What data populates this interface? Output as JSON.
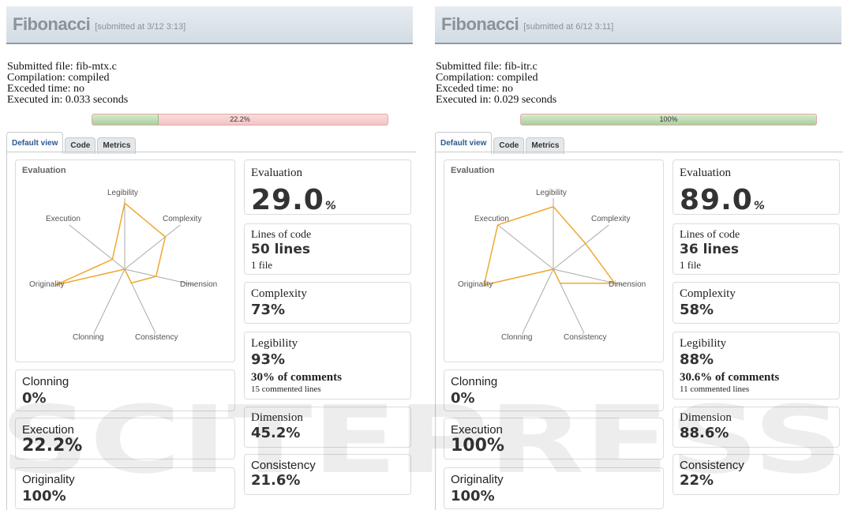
{
  "colors": {
    "orange": "#f0a830",
    "axis": "#aaaaaa",
    "header_text": "#8a929a",
    "tab_active": "#2b5893",
    "progress_red": "#f4c4c4",
    "progress_green": "#a9cf9c"
  },
  "panels": [
    {
      "header": {
        "title": "Fibonacci",
        "subtitle": "[submitted at 3/12 3:13]"
      },
      "info": {
        "submitted_file": "Submitted file: fib-mtx.c",
        "compilation": "Compilation: compiled",
        "exceeded_time": "Exceded time: no",
        "executed_in": "Executed in: 0.033 seconds"
      },
      "progress": {
        "label": "22.2%",
        "fraction": 0.222
      },
      "tabs": {
        "default_view": "Default view",
        "code": "Code",
        "metrics": "Metrics"
      },
      "radar": {
        "title": "Evaluation",
        "axes": [
          "Legibility",
          "Complexity",
          "Dimension",
          "Consistency",
          "Clonning",
          "Originality",
          "Execution"
        ],
        "values": [
          0.93,
          0.73,
          0.452,
          0.216,
          0.0,
          1.0,
          0.222
        ]
      },
      "evaluation": {
        "title": "Evaluation",
        "value": "29.0",
        "unit": "%"
      },
      "lines_of_code": {
        "title": "Lines of code",
        "value": "50 lines",
        "files": "1 file"
      },
      "complexity": {
        "title": "Complexity",
        "value": "73%"
      },
      "legibility": {
        "title": "Legibility",
        "value": "93%",
        "comments": "30% of comments",
        "commented_lines": "15 commented lines"
      },
      "dimension": {
        "title": "Dimension",
        "value": "45.2%"
      },
      "consistency": {
        "title": "Consistency",
        "value": "21.6%"
      },
      "clonning": {
        "title": "Clonning",
        "value": "0%"
      },
      "execution": {
        "title": "Execution",
        "value": "22.2%"
      },
      "originality": {
        "title": "Originality",
        "value": "100%"
      }
    },
    {
      "header": {
        "title": "Fibonacci",
        "subtitle": "[submitted at 6/12 3:11]"
      },
      "info": {
        "submitted_file": "Submitted file: fib-itr.c",
        "compilation": "Compilation: compiled",
        "exceeded_time": "Exceded time: no",
        "executed_in": "Executed in: 0.029 seconds"
      },
      "progress": {
        "label": "100%",
        "fraction": 1.0
      },
      "tabs": {
        "default_view": "Default view",
        "code": "Code",
        "metrics": "Metrics"
      },
      "radar": {
        "title": "Evaluation",
        "axes": [
          "Legibility",
          "Complexity",
          "Dimension",
          "Consistency",
          "Clonning",
          "Originality",
          "Execution"
        ],
        "values": [
          0.88,
          0.58,
          0.886,
          0.22,
          0.0,
          1.0,
          1.0
        ]
      },
      "evaluation": {
        "title": "Evaluation",
        "value": "89.0",
        "unit": "%"
      },
      "lines_of_code": {
        "title": "Lines of code",
        "value": "36 lines",
        "files": "1 file"
      },
      "complexity": {
        "title": "Complexity",
        "value": "58%"
      },
      "legibility": {
        "title": "Legibility",
        "value": "88%",
        "comments": "30.6% of comments",
        "commented_lines": "11 commented lines"
      },
      "dimension": {
        "title": "Dimension",
        "value": "88.6%"
      },
      "consistency": {
        "title": "Consistency",
        "value": "22%"
      },
      "clonning": {
        "title": "Clonning",
        "value": "0%"
      },
      "execution": {
        "title": "Execution",
        "value": "100%"
      },
      "originality": {
        "title": "Originality",
        "value": "100%"
      }
    }
  ],
  "watermark": "SCITEPRESS"
}
